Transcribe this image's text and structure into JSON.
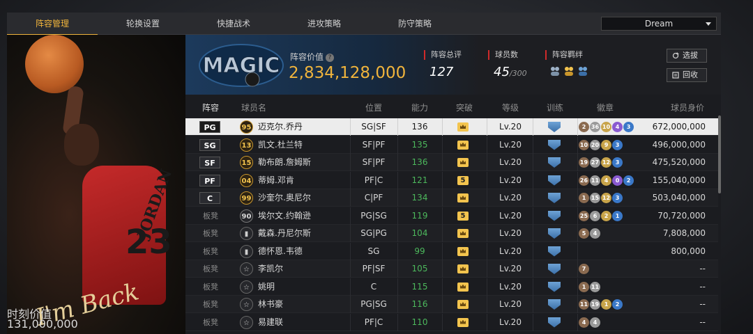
{
  "tabs": [
    "阵容管理",
    "轮换设置",
    "快捷战术",
    "进攻策略",
    "防守策略"
  ],
  "active_tab": 0,
  "dropdown": {
    "value": "Dream"
  },
  "poster": {
    "signature": "I'm Back",
    "jersey_name": "JORDAN",
    "jersey_number": "23",
    "value_label": "时刻价值",
    "value": "131,000,000"
  },
  "team": {
    "logo_text": "MAGIC",
    "value_label": "阵容价值",
    "value": "2,834,128,000",
    "rating_label": "阵容总评",
    "rating": "127",
    "players_label": "球员数",
    "players_count": "45",
    "players_max": "/300",
    "bond_label": "阵容羁绊"
  },
  "buttons": {
    "select": "选拔",
    "recycle": "回收"
  },
  "columns": [
    "阵容",
    "球员名",
    "位置",
    "能力",
    "突破",
    "等级",
    "训练",
    "徽章",
    "球员身价"
  ],
  "rows": [
    {
      "slot": "PG",
      "starter": true,
      "rank": "95",
      "rank_style": "gold",
      "name": "迈克尔.乔丹",
      "position": "SG|SF",
      "ability": "136",
      "breakthrough": "crown",
      "level": "Lv.20",
      "badges": [
        [
          "2",
          "#8a6a50"
        ],
        [
          "36",
          "#9a9a9a"
        ],
        [
          "10",
          "#c8a44a"
        ],
        [
          "4",
          "#8a5ad0"
        ],
        [
          "3",
          "#3a78c8"
        ]
      ],
      "price": "672,000,000"
    },
    {
      "slot": "SG",
      "starter": true,
      "rank": "13",
      "rank_style": "gold",
      "name": "凯文.杜兰特",
      "position": "SF|PF",
      "ability": "135",
      "breakthrough": "crown",
      "level": "Lv.20",
      "badges": [
        [
          "10",
          "#8a6a50"
        ],
        [
          "20",
          "#9a9a9a"
        ],
        [
          "9",
          "#c8a44a"
        ],
        [
          "3",
          "#3a78c8"
        ]
      ],
      "price": "496,000,000"
    },
    {
      "slot": "SF",
      "starter": true,
      "rank": "15",
      "rank_style": "gold",
      "name": "勒布朗.詹姆斯",
      "position": "SF|PF",
      "ability": "136",
      "breakthrough": "crown",
      "level": "Lv.20",
      "badges": [
        [
          "19",
          "#8a6a50"
        ],
        [
          "27",
          "#9a9a9a"
        ],
        [
          "12",
          "#c8a44a"
        ],
        [
          "3",
          "#3a78c8"
        ]
      ],
      "price": "475,520,000"
    },
    {
      "slot": "PF",
      "starter": true,
      "rank": "04",
      "rank_style": "gold",
      "name": "蒂姆.邓肯",
      "position": "PF|C",
      "ability": "121",
      "breakthrough": "5",
      "level": "Lv.20",
      "badges": [
        [
          "26",
          "#8a6a50"
        ],
        [
          "11",
          "#9a9a9a"
        ],
        [
          "4",
          "#c8a44a"
        ],
        [
          "0",
          "#8a5ad0"
        ],
        [
          "2",
          "#3a78c8"
        ]
      ],
      "price": "155,040,000"
    },
    {
      "slot": "C",
      "starter": true,
      "rank": "99",
      "rank_style": "gold",
      "name": "沙奎尔.奥尼尔",
      "position": "C|PF",
      "ability": "134",
      "breakthrough": "crown",
      "level": "Lv.20",
      "badges": [
        [
          "1",
          "#8a6a50"
        ],
        [
          "15",
          "#9a9a9a"
        ],
        [
          "12",
          "#c8a44a"
        ],
        [
          "3",
          "#3a78c8"
        ]
      ],
      "price": "503,040,000"
    },
    {
      "slot": "板凳",
      "starter": false,
      "rank": "90",
      "rank_style": "silver",
      "name": "埃尔文.约翰逊",
      "position": "PG|SG",
      "ability": "119",
      "breakthrough": "5",
      "level": "Lv.20",
      "badges": [
        [
          "25",
          "#8a6a50"
        ],
        [
          "6",
          "#9a9a9a"
        ],
        [
          "2",
          "#c8a44a"
        ],
        [
          "1",
          "#3a78c8"
        ]
      ],
      "price": "70,720,000"
    },
    {
      "slot": "板凳",
      "starter": false,
      "rank": "bars",
      "rank_style": "icon",
      "name": "戴森.丹尼尔斯",
      "position": "SG|PG",
      "ability": "104",
      "breakthrough": "crown",
      "level": "Lv.20",
      "badges": [
        [
          "5",
          "#8a6a50"
        ],
        [
          "4",
          "#9a9a9a"
        ]
      ],
      "price": "7,808,000"
    },
    {
      "slot": "板凳",
      "starter": false,
      "rank": "bars",
      "rank_style": "icon",
      "name": "德怀恩.韦德",
      "position": "SG",
      "ability": "99",
      "breakthrough": "crown",
      "level": "Lv.20",
      "badges": [],
      "price": "800,000"
    },
    {
      "slot": "板凳",
      "starter": false,
      "rank": "☆",
      "rank_style": "icon",
      "name": "李凯尔",
      "position": "PF|SF",
      "ability": "105",
      "breakthrough": "crown",
      "level": "Lv.20",
      "badges": [
        [
          "7",
          "#8a6a50"
        ]
      ],
      "price": "--"
    },
    {
      "slot": "板凳",
      "starter": false,
      "rank": "☆",
      "rank_style": "icon",
      "name": "姚明",
      "position": "C",
      "ability": "115",
      "breakthrough": "crown",
      "level": "Lv.20",
      "badges": [
        [
          "1",
          "#8a6a50"
        ],
        [
          "11",
          "#9a9a9a"
        ]
      ],
      "price": "--"
    },
    {
      "slot": "板凳",
      "starter": false,
      "rank": "☆",
      "rank_style": "icon",
      "name": "林书豪",
      "position": "PG|SG",
      "ability": "116",
      "breakthrough": "crown",
      "level": "Lv.20",
      "badges": [
        [
          "11",
          "#8a6a50"
        ],
        [
          "19",
          "#9a9a9a"
        ],
        [
          "1",
          "#c8a44a"
        ],
        [
          "2",
          "#3a78c8"
        ]
      ],
      "price": "--"
    },
    {
      "slot": "板凳",
      "starter": false,
      "rank": "☆",
      "rank_style": "icon",
      "name": "易建联",
      "position": "PF|C",
      "ability": "110",
      "breakthrough": "crown",
      "level": "Lv.20",
      "badges": [
        [
          "4",
          "#8a6a50"
        ],
        [
          "4",
          "#9a9a9a"
        ]
      ],
      "price": "--"
    }
  ],
  "colors": {
    "accent": "#f0b43c",
    "ability_green": "#4cb85c",
    "divider_red": "#d02a2a"
  }
}
